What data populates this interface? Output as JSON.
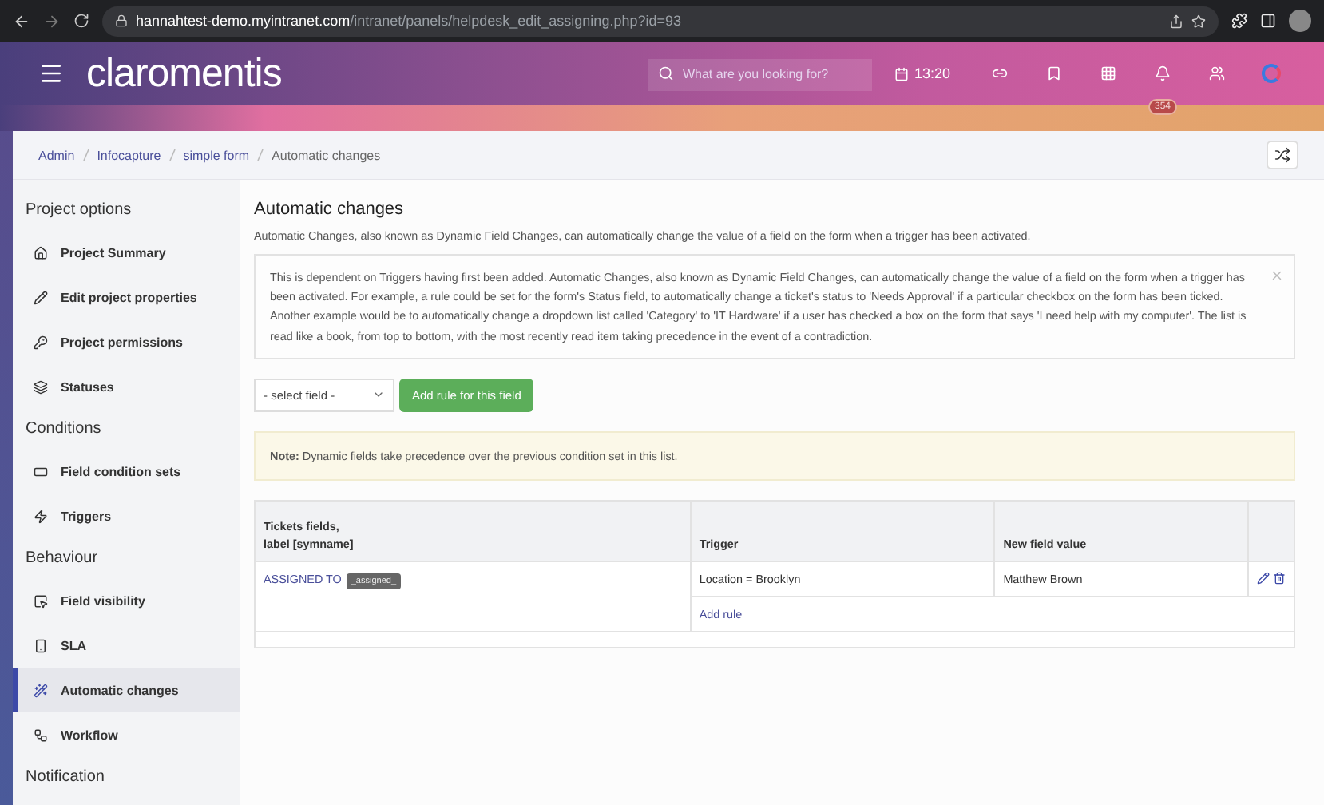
{
  "browser": {
    "url_host": "hannahtest-demo.myintranet.com",
    "url_path": "/intranet/panels/helpdesk_edit_assigning.php?id=93"
  },
  "header": {
    "logo": "claromentis",
    "search_placeholder": "What are you looking for?",
    "time": "13:20",
    "notification_count": "354"
  },
  "breadcrumb": [
    "Admin",
    "Infocapture",
    "simple form",
    "Automatic changes"
  ],
  "sidebar": [
    {
      "heading": "Project options",
      "items": [
        {
          "label": "Project Summary",
          "selected": false
        },
        {
          "label": "Edit project properties",
          "selected": false
        },
        {
          "label": "Project permissions",
          "selected": false
        },
        {
          "label": "Statuses",
          "selected": false
        }
      ]
    },
    {
      "heading": "Conditions",
      "items": [
        {
          "label": "Field condition sets",
          "selected": false
        },
        {
          "label": "Triggers",
          "selected": false
        }
      ]
    },
    {
      "heading": "Behaviour",
      "items": [
        {
          "label": "Field visibility",
          "selected": false
        },
        {
          "label": "SLA",
          "selected": false
        },
        {
          "label": "Automatic changes",
          "selected": true
        },
        {
          "label": "Workflow",
          "selected": false
        }
      ]
    },
    {
      "heading": "Notification"
    }
  ],
  "main": {
    "title": "Automatic changes",
    "description": "Automatic Changes, also known as Dynamic Field Changes, can automatically change the value of a field on the form when a trigger has been activated.",
    "info": "This is dependent on Triggers having first been added. Automatic Changes, also known as Dynamic Field Changes, can automatically change the value of a field on the form when a trigger has been activated. For example, a rule could be set for the form's Status field, to automatically change a ticket's status to 'Needs Approval' if a particular checkbox on the form has been ticked. Another example would be to automatically change a dropdown list called 'Category' to 'IT Hardware' if a user has checked a box on the form that says 'I need help with my computer'. The list is read like a book, from top to bottom, with the most recently read item taking precedence in the event of a contradiction.",
    "select_value": "- select field -",
    "add_button": "Add rule for this field",
    "note": "**Note:** Dynamic fields take precedence over the previous condition set in this list."
  },
  "table": {
    "columns": [
      "Tickets fields,\nlabel [symname]",
      "Trigger",
      "New field value"
    ],
    "rows": [
      {
        "field": "ASSIGNED TO",
        "symname": "_assigned_",
        "trigger": "Location = Brooklyn",
        "value": "Matthew Brown"
      }
    ],
    "add_rule": "Add rule"
  }
}
